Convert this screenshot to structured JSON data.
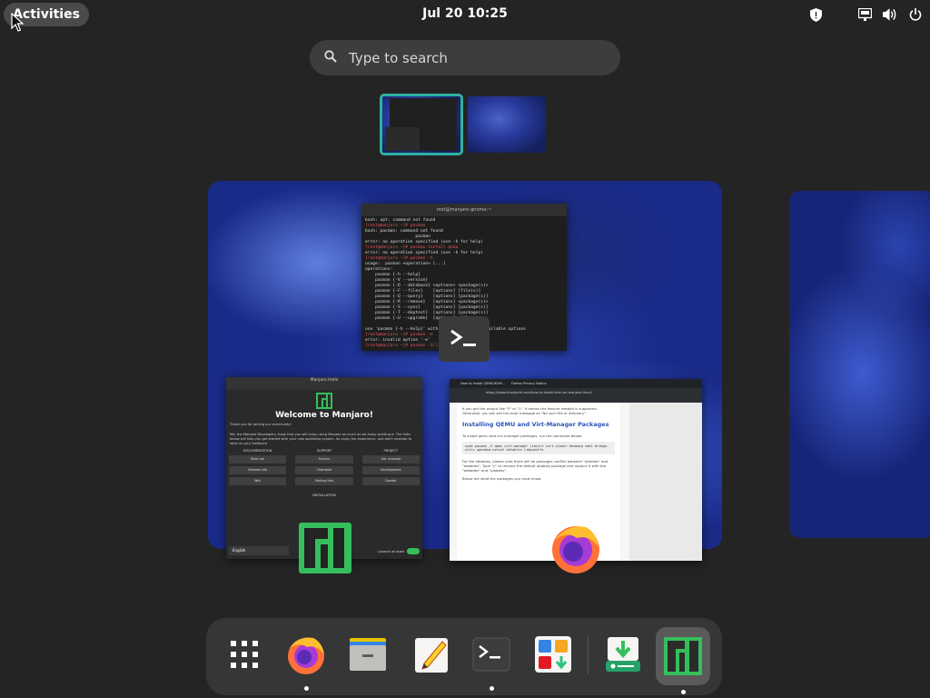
{
  "topbar": {
    "activities_label": "Activities",
    "clock": "Jul 20  10:25",
    "tray_icons": [
      "security-shield-icon",
      "network-icon",
      "volume-icon",
      "power-icon"
    ]
  },
  "search": {
    "placeholder": "Type to search"
  },
  "workspaces": {
    "thumbnails": [
      {
        "name": "workspace-1",
        "active": true
      },
      {
        "name": "workspace-2",
        "active": false
      }
    ]
  },
  "windows": {
    "terminal": {
      "title": "root@manjaro-gnome:~",
      "lines": [
        "bash: opt: command not found",
        "[root@manjaro ~]# pacman",
        "bash: pacman: command not found",
        "                    pacman",
        "error: no operation specified (use -h for help)",
        "[root@manjaro ~]# pacman install qemu",
        "error: no operation specified (use -h for help)",
        "[root@manjaro ~]# pacman -h",
        "usage:  pacman <operation> [...]",
        "operations:",
        "    pacman {-h --help}",
        "    pacman {-V --version}",
        "    pacman {-D --database} <options> <package(s)>",
        "    pacman {-F --files}    [options] [file(s)]",
        "    pacman {-Q --query}    [options] [package(s)]",
        "    pacman {-R --remove}   [options] <package(s)>",
        "    pacman {-S --sync}     [options] [package(s)]",
        "    pacman {-T --deptest}  [options] [package(s)]",
        "    pacman {-U --upgrade}  [options] <file(s)>",
        "",
        "use 'pacman {-h --help}' with an operation for available options",
        "[root@manjaro ~]# pacman -e",
        "error: invalid option '-e'",
        "[root@manjaro ~]# pacman -S[]"
      ]
    },
    "welcome": {
      "window_title": "Manjaro Hello",
      "heading": "Welcome to Manjaro!",
      "intro": "Thank you for joining our community!",
      "body": "We, the Manjaro Developers, hope that you will enjoy using Manjaro as much as we enjoy building it. The links below will help you get started with your new operating system. So enjoy the experience, and don't hesitate to send us your feedback.",
      "columns": [
        "DOCUMENTATION",
        "SUPPORT",
        "PROJECT"
      ],
      "buttons": [
        "Read me",
        "Forums",
        "Get involved",
        "Release info",
        "Chatroom",
        "Development",
        "Wiki",
        "Mailing lists",
        "Donate"
      ],
      "installation_label": "INSTALLATION",
      "language": "English",
      "launch_at_start": "Launch at start"
    },
    "browser": {
      "tab_title": "How to Install QEMU/KVM...",
      "tab2_title": "Firefox Privacy Notice",
      "url": "https://www.linuxtechi.com/how-to-install-kvm-on-manjaro-linux/",
      "intro": "If you get the output like \"Y\" or \"1\", it means the feature needed is supported. Otherwise, you will see the error message as \"No such file or directory\".",
      "heading": "Installing QEMU and Virt-Manager Packages",
      "step": "To install qemu and virt-manager packages, run the command below.",
      "code": "sudo pacman -S qemu virt-manager libvirt virt-viewer dnsmasq vde2 bridge-utils openbsd-netcat ebtables libguestfs",
      "after": "For the ebtables, please note there will be packages conflict between \"iptables\" and \"ebtables\". Type \"y\" to remove the default iptables package and replace it with the \"ebtables\" and \"iptables\".",
      "below": "Below are what the packages you must know:"
    }
  },
  "dock": {
    "items": [
      {
        "name": "show-apps",
        "running": false
      },
      {
        "name": "firefox",
        "running": true
      },
      {
        "name": "files",
        "running": false
      },
      {
        "name": "text-editor",
        "running": false
      },
      {
        "name": "terminal",
        "running": true
      },
      {
        "name": "software",
        "running": false
      },
      {
        "name": "installer",
        "running": false
      },
      {
        "name": "manjaro-hello",
        "running": true
      }
    ]
  },
  "colors": {
    "accent": "#2fb1a1",
    "manjaro_green": "#35bf5c",
    "panel": "#242424",
    "dock": "#363636"
  }
}
